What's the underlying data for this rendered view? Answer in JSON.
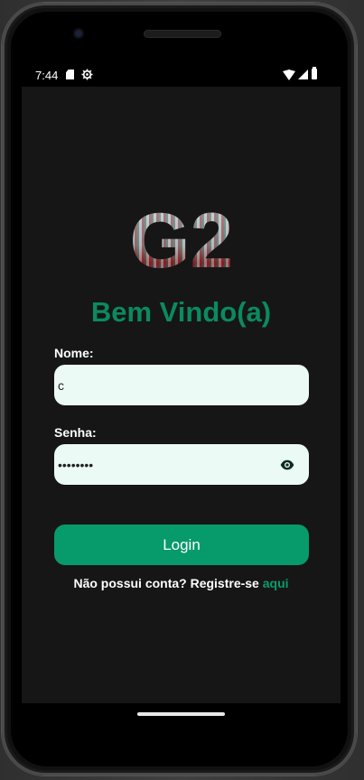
{
  "statusbar": {
    "time": "7:44"
  },
  "app": {
    "logo_text": "G2",
    "title": "Bem Vindo(a)",
    "name_label": "Nome:",
    "name_value": "c",
    "password_label": "Senha:",
    "password_value": "••••••••",
    "login_button": "Login",
    "register_prompt": "Não possui conta? Registre-se",
    "register_link": "aqui"
  },
  "colors": {
    "accent": "#079a6a",
    "title": "#0b8a5f",
    "field_background": "#ecfaf5",
    "screen_background": "#161616"
  },
  "icons": [
    "sd-card-icon",
    "gear-icon",
    "wifi-icon",
    "signal-icon",
    "battery-icon",
    "eye-icon"
  ]
}
